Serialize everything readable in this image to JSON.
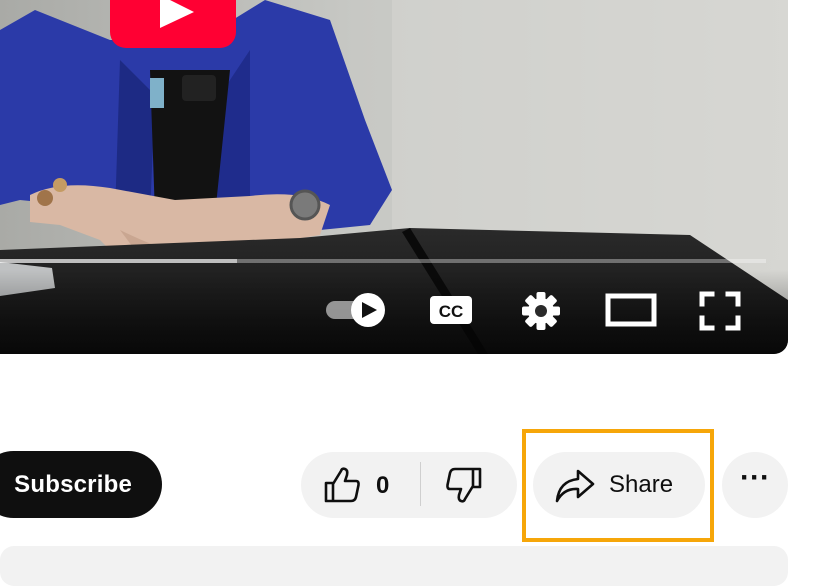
{
  "player": {
    "controls": {
      "autoplay": {
        "icon": "autoplay-toggle-icon"
      },
      "captions": {
        "label": "CC",
        "icon": "captions-icon"
      },
      "settings": {
        "icon": "gear-icon"
      },
      "theater": {
        "icon": "theater-mode-icon"
      },
      "fullscreen": {
        "icon": "fullscreen-icon"
      }
    },
    "progress": {
      "loaded_fraction": 0.31
    }
  },
  "actions": {
    "subscribe_label": "Subscribe",
    "like": {
      "icon": "thumbs-up-icon",
      "count": "0"
    },
    "dislike": {
      "icon": "thumbs-down-icon"
    },
    "share": {
      "icon": "share-icon",
      "label": "Share"
    },
    "more": {
      "icon": "more-options-icon",
      "label": "···"
    }
  },
  "colors": {
    "highlight": "#f6a609",
    "subscribe_bg": "#0f0f0f",
    "pill_bg": "#f2f2f2",
    "youtube_red": "#ff0033"
  }
}
